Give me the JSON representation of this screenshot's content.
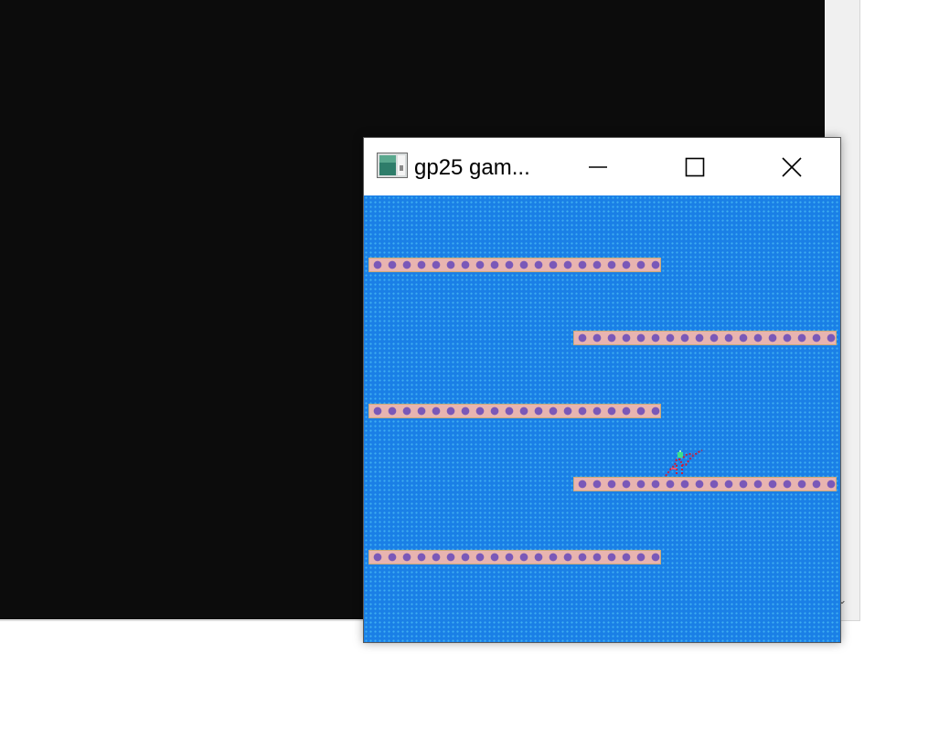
{
  "background_window": {
    "scroll_down_glyph": "⌄"
  },
  "game_window": {
    "title": "gp25 gam...",
    "icon": "app-window-icon",
    "controls": {
      "minimize": "minimize-icon",
      "maximize": "maximize-icon",
      "close": "close-icon"
    },
    "colors": {
      "sky": "#1a7fe6",
      "sky_dots": "#3fb0f0",
      "platform_base": "#e8b4b0",
      "platform_tile": "#7a58b8",
      "player": "#c81e3c",
      "player_head": "#3ce08c"
    },
    "platforms": [
      {
        "id": "platform-1",
        "side": "left"
      },
      {
        "id": "platform-2",
        "side": "right"
      },
      {
        "id": "platform-3",
        "side": "left"
      },
      {
        "id": "platform-4",
        "side": "right"
      },
      {
        "id": "platform-5",
        "side": "left"
      }
    ],
    "player": {
      "sprite": "player-sprite",
      "on_platform": "platform-4"
    }
  }
}
